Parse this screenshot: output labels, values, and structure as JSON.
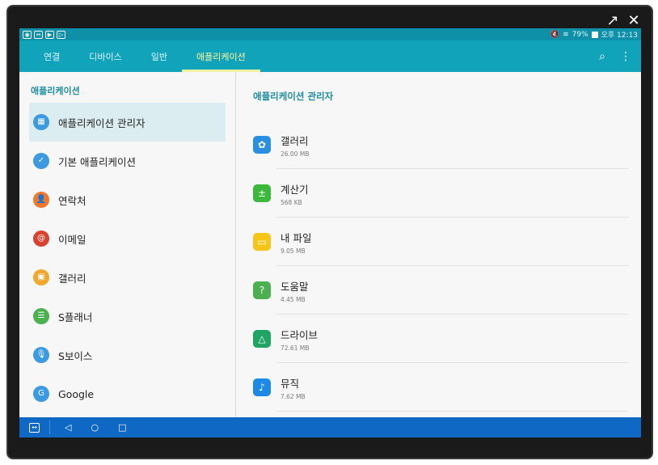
{
  "window_controls": {
    "external_icon": "external-link",
    "close_icon": "✕"
  },
  "statusbar": {
    "icons": [
      "eye-icon",
      "teamviewer-icon",
      "youtube-icon",
      "play-store-icon"
    ],
    "battery": "79%",
    "time": "오후 12:13"
  },
  "tabs": [
    {
      "label": "연결",
      "active": false
    },
    {
      "label": "디바이스",
      "active": false
    },
    {
      "label": "일반",
      "active": false
    },
    {
      "label": "애플리케이션",
      "active": true
    }
  ],
  "left": {
    "title": "애플리케이션",
    "items": [
      {
        "label": "애플리케이션 관리자",
        "icon": "apps-grid-icon",
        "color": "#3c9be0",
        "active": true
      },
      {
        "label": "기본 애플리케이션",
        "icon": "default-apps-icon",
        "color": "#3c9be0",
        "active": false
      },
      {
        "label": "연락처",
        "icon": "contacts-icon",
        "color": "#f0782a",
        "active": false
      },
      {
        "label": "이메일",
        "icon": "email-icon",
        "color": "#d8422f",
        "active": false
      },
      {
        "label": "갤러리",
        "icon": "gallery-icon",
        "color": "#f0a830",
        "active": false
      },
      {
        "label": "S플래너",
        "icon": "planner-icon",
        "color": "#4caf50",
        "active": false
      },
      {
        "label": "S보이스",
        "icon": "voice-icon",
        "color": "#3c9be0",
        "active": false
      },
      {
        "label": "Google",
        "icon": "google-icon",
        "color": "#3c9be0",
        "active": false
      }
    ]
  },
  "right": {
    "title": "애플리케이션 관리자",
    "apps": [
      {
        "name": "갤러리",
        "size": "26.00 MB",
        "icon": "gallery-app-icon",
        "color": "#2a8fe0"
      },
      {
        "name": "계산기",
        "size": "568 KB",
        "icon": "calculator-icon",
        "color": "#3cb83c"
      },
      {
        "name": "내 파일",
        "size": "9.05 MB",
        "icon": "my-files-icon",
        "color": "#f5c518"
      },
      {
        "name": "도움말",
        "size": "4.45 MB",
        "icon": "help-icon",
        "color": "#4caf50"
      },
      {
        "name": "드라이브",
        "size": "72.61 MB",
        "icon": "drive-icon",
        "color": "#1fa463"
      },
      {
        "name": "뮤직",
        "size": "7.62 MB",
        "icon": "music-icon",
        "color": "#1e88e5"
      }
    ]
  },
  "navbar": {
    "icons": [
      "teamviewer-icon",
      "back-icon",
      "home-icon",
      "recents-icon"
    ]
  }
}
